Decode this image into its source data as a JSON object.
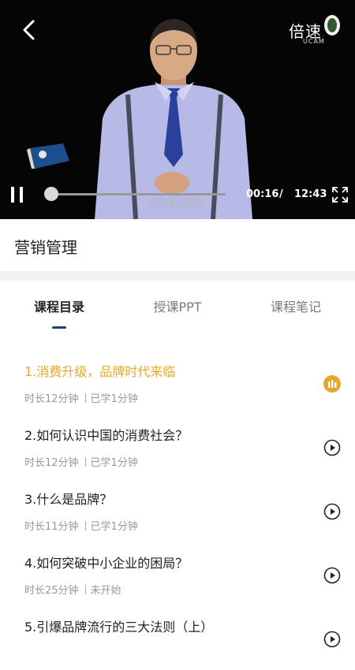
{
  "player": {
    "logo_text": "倍速",
    "logo_sub": "UCAM",
    "subtitle": "各位学员朋友",
    "current_time": "00:16",
    "separator": "/",
    "total_time": "12:43",
    "progress": 0.02,
    "icons": [
      "back-icon",
      "pause-icon",
      "fullscreen-icon"
    ]
  },
  "course": {
    "title": "营销管理"
  },
  "tabs": [
    {
      "label": "课程目录",
      "active": true
    },
    {
      "label": "授课PPT",
      "active": false
    },
    {
      "label": "课程笔记",
      "active": false
    }
  ],
  "lessons": [
    {
      "title": "1.消费升级，品牌时代来临",
      "duration": "时长12分钟",
      "status": "已学1分钟",
      "playing": true
    },
    {
      "title": "2.如何认识中国的消费社会？",
      "duration": "时长12分钟",
      "status": "已学1分钟",
      "playing": false
    },
    {
      "title": "3.什么是品牌？",
      "duration": "时长11分钟",
      "status": "已学1分钟",
      "playing": false
    },
    {
      "title": "4.如何突破中小企业的困局？",
      "duration": "时长25分钟",
      "status": "未开始",
      "playing": false
    },
    {
      "title": "5.引爆品牌流行的三大法则（上）",
      "duration": "",
      "status": "",
      "playing": false
    }
  ],
  "colors": {
    "accent": "#e3a92a",
    "tab_indicator": "#1c3f73",
    "video_bg": "#050505"
  }
}
